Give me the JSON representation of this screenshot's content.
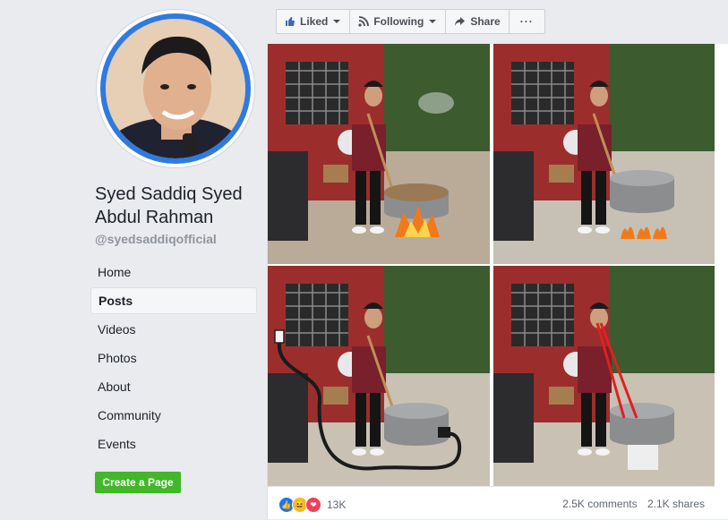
{
  "page": {
    "name": "Syed Saddiq Syed Abdul Rahman",
    "handle": "@syedsaddiqofficial"
  },
  "nav": {
    "items": [
      {
        "label": "Home"
      },
      {
        "label": "Posts"
      },
      {
        "label": "Videos"
      },
      {
        "label": "Photos"
      },
      {
        "label": "About"
      },
      {
        "label": "Community"
      },
      {
        "label": "Events"
      }
    ],
    "active": "Posts"
  },
  "create_page_label": "Create a Page",
  "actions": {
    "liked": "Liked",
    "following": "Following",
    "share": "Share",
    "more": "···"
  },
  "post": {
    "reaction_count": "13K",
    "comments": "2.5K comments",
    "shares": "2.1K shares",
    "reaction_icons": [
      "like-icon",
      "haha-icon",
      "love-icon"
    ]
  },
  "colors": {
    "fb_blue": "#4267b2",
    "avatar_ring": "#2f7ae0",
    "create_green": "#42b72a"
  }
}
